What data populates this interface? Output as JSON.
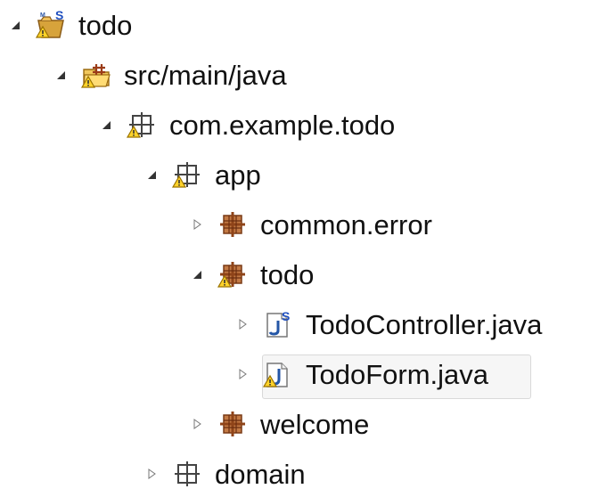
{
  "tree": {
    "items": [
      {
        "label": "todo",
        "expanded": true,
        "icon": "spring-maven-project-warning-icon"
      },
      {
        "label": "src/main/java",
        "expanded": true,
        "icon": "source-folder-warning-icon"
      },
      {
        "label": "com.example.todo",
        "expanded": true,
        "icon": "empty-package-warning-icon"
      },
      {
        "label": "app",
        "expanded": true,
        "icon": "empty-package-warning-icon"
      },
      {
        "label": "common.error",
        "expanded": false,
        "icon": "package-icon"
      },
      {
        "label": "todo",
        "expanded": true,
        "icon": "package-warning-icon"
      },
      {
        "label": "TodoController.java",
        "expanded": false,
        "icon": "spring-java-file-icon"
      },
      {
        "label": "TodoForm.java",
        "expanded": false,
        "selected": true,
        "icon": "java-file-warning-icon"
      },
      {
        "label": "welcome",
        "expanded": false,
        "icon": "package-icon"
      },
      {
        "label": "domain",
        "expanded": false,
        "icon": "empty-package-icon"
      }
    ]
  },
  "colors": {
    "package_brown": "#a45b2b",
    "warning_yellow": "#ffd32a",
    "java_blue": "#2456a6",
    "spring_green": "#3f8f2d",
    "selection_bg": "#f6f6f6"
  }
}
